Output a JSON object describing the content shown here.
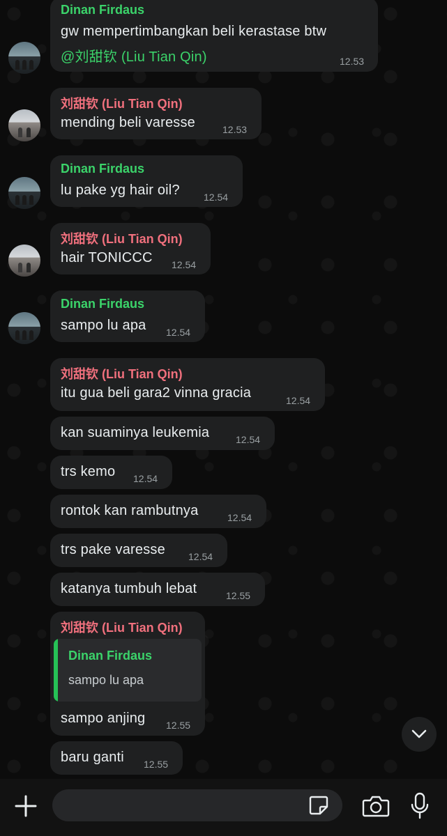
{
  "messages": [
    {
      "sender": "Dinan Firdaus",
      "text": "gw mempertimbangkan beli kerastase btw",
      "mention_at": "@",
      "mention": "刘甜钦 (Liu Tian Qin)",
      "time": "12.53"
    },
    {
      "sender": "刘甜钦 (Liu Tian Qin)",
      "text": "mending beli varesse",
      "time": "12.53"
    },
    {
      "sender": "Dinan Firdaus",
      "text": "lu pake yg hair oil?",
      "time": "12.54"
    },
    {
      "sender": "刘甜钦 (Liu Tian Qin)",
      "text": "hair TONICCC",
      "time": "12.54"
    },
    {
      "sender": "Dinan Firdaus",
      "text": "sampo lu apa",
      "time": "12.54"
    },
    {
      "sender": "刘甜钦 (Liu Tian Qin)",
      "text": "itu gua beli gara2 vinna gracia",
      "time": "12.54"
    },
    {
      "text": "kan suaminya leukemia",
      "time": "12.54"
    },
    {
      "text": "trs kemo",
      "time": "12.54"
    },
    {
      "text": "rontok kan rambutnya",
      "time": "12.54"
    },
    {
      "text": "trs pake varesse",
      "time": "12.54"
    },
    {
      "text": "katanya tumbuh lebat",
      "time": "12.55"
    },
    {
      "sender": "刘甜钦 (Liu Tian Qin)",
      "reply_to": {
        "sender": "Dinan Firdaus",
        "text": "sampo lu apa"
      },
      "text": "sampo anjing",
      "time": "12.55"
    },
    {
      "text": "baru ganti",
      "time": "12.55"
    }
  ],
  "input": {
    "placeholder": "",
    "value": ""
  },
  "colors": {
    "green_name": "#3bd36a",
    "pink_name": "#f0707d",
    "bubble": "#1f2021",
    "background": "#0c0c0c"
  },
  "icons": [
    "plus-icon",
    "sticker-icon",
    "camera-icon",
    "microphone-icon",
    "chevron-down-icon"
  ]
}
